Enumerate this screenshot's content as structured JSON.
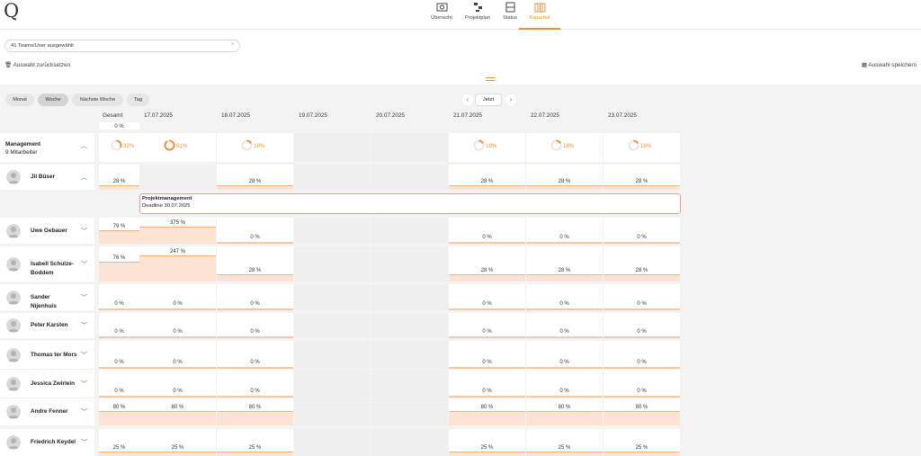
{
  "app": {
    "logo": "Q"
  },
  "nav": [
    {
      "label": "Übersicht",
      "icon": "overview-icon"
    },
    {
      "label": "Projektplan",
      "icon": "project-plan-icon"
    },
    {
      "label": "Status",
      "icon": "status-icon"
    },
    {
      "label": "Kapazität",
      "icon": "capacity-icon",
      "active": true
    }
  ],
  "filter": {
    "selection": "41 Teams/User ausgewählt",
    "reset_label": "Auswahl zurücksetzen",
    "save_label": "Auswahl speichern"
  },
  "view": {
    "modes": [
      "Monat",
      "Woche",
      "Nächste Woche",
      "Tag"
    ],
    "active": "Woche",
    "today_label": "Jetzt"
  },
  "columns": {
    "total": "Gesamt",
    "days": [
      "17.07.2025",
      "18.07.2025",
      "19.07.2025",
      "20.07.2025",
      "21.07.2025",
      "22.07.2025",
      "23.07.2025"
    ]
  },
  "top_partial": "0 %",
  "team": {
    "name": "Management",
    "members": "9 Mitarbeiter",
    "total": "32%",
    "days": [
      "91%",
      "18%",
      "",
      "",
      "18%",
      "18%",
      "18%"
    ],
    "total_value": 32,
    "day_values": [
      91,
      18,
      null,
      null,
      18,
      18,
      18
    ]
  },
  "task": {
    "title": "Projektmanagement",
    "deadline": "Deadline 30.07.2025"
  },
  "people": [
    {
      "name": "Jil Büser",
      "total": "28 %",
      "days": [
        "",
        "28 %",
        "",
        "",
        "28 %",
        "28 %",
        "28 %"
      ],
      "expanded": true
    },
    {
      "name": "Uwe Gebauer",
      "total": "79 %",
      "days": [
        "375 %",
        "0 %",
        "",
        "",
        "0 %",
        "0 %",
        "0 %"
      ]
    },
    {
      "name": "Isabell Schulze-Boddem",
      "total": "76 %",
      "days": [
        "247 %",
        "28 %",
        "",
        "",
        "28 %",
        "28 %",
        "28 %"
      ]
    },
    {
      "name": "Sander Nijenhuis",
      "total": "0 %",
      "days": [
        "0 %",
        "0 %",
        "",
        "",
        "0 %",
        "0 %",
        "0 %"
      ]
    },
    {
      "name": "Peter Karsten",
      "total": "0 %",
      "days": [
        "0 %",
        "0 %",
        "",
        "",
        "0 %",
        "0 %",
        "0 %"
      ]
    },
    {
      "name": "Thomas ter Mors",
      "total": "0 %",
      "days": [
        "0 %",
        "0 %",
        "",
        "",
        "0 %",
        "0 %",
        "0 %"
      ]
    },
    {
      "name": "Jessica Zwirlein",
      "total": "0 %",
      "days": [
        "0 %",
        "0 %",
        "",
        "",
        "0 %",
        "0 %",
        "0 %"
      ]
    },
    {
      "name": "Andre Fenner",
      "total": "80 %",
      "days": [
        "80 %",
        "80 %",
        "",
        "",
        "80 %",
        "80 %",
        "80 %"
      ]
    },
    {
      "name": "Friedrich Keydel",
      "total": "25 %",
      "days": [
        "25 %",
        "25 %",
        "",
        "",
        "25 %",
        "25 %",
        "25 %"
      ]
    }
  ],
  "colors": {
    "accent": "#e8923f",
    "load_fill": "#fde3d2",
    "task_border": "#e89a9a"
  }
}
